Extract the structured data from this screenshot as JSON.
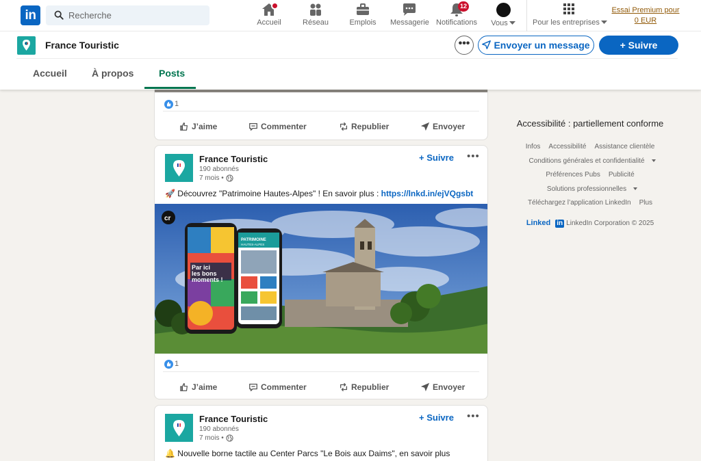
{
  "nav": {
    "logo": "in",
    "search_placeholder": "Recherche",
    "items": [
      {
        "label": "Accueil",
        "icon": "home-icon"
      },
      {
        "label": "Réseau",
        "icon": "network-icon"
      },
      {
        "label": "Emplois",
        "icon": "briefcase-icon"
      },
      {
        "label": "Messagerie",
        "icon": "messaging-icon"
      },
      {
        "label": "Notifications",
        "icon": "bell-icon",
        "badge": "12"
      },
      {
        "label": "Vous",
        "icon": "avatar"
      },
      {
        "label": "Pour les entreprises",
        "icon": "grid-icon"
      }
    ],
    "premium": "Essai Premium pour 0 EUR"
  },
  "page": {
    "name": "France Touristic",
    "more": "•••",
    "message_button": "Envoyer un message",
    "follow_button": "+ Suivre",
    "tabs": [
      "Accueil",
      "À propos",
      "Posts"
    ],
    "active_tab": "Posts"
  },
  "posts": [
    {
      "reaction_count": "1",
      "actions": [
        "J’aime",
        "Commenter",
        "Republier",
        "Envoyer"
      ]
    },
    {
      "author": "France Touristic",
      "followers": "190 abonnés",
      "time": "7 mois •",
      "follow": "+ Suivre",
      "more": "•••",
      "text_emoji": "🚀",
      "text": "Découvrez \"Patrimoine Hautes-Alpes\" ! En savoir plus : ",
      "link": "https://lnkd.in/ejVQgsbt",
      "image": {
        "badge": "cr",
        "phone_brand": "PATRIMOINE",
        "phone_brand_sub": "HAUTES-ALPES",
        "phone_slogan": "Par ici les bons moments !"
      },
      "reaction_count": "1",
      "actions": [
        "J’aime",
        "Commenter",
        "Republier",
        "Envoyer"
      ]
    },
    {
      "author": "France Touristic",
      "followers": "190 abonnés",
      "time": "7 mois •",
      "follow": "+ Suivre",
      "more": "•••",
      "text_emoji": "🔔",
      "text": "Nouvelle borne tactile au Center Parcs \"Le Bois aux Daims\", en savoir plus"
    }
  ],
  "rail": {
    "title": "Accessibilité : partiellement conforme",
    "links_row1": [
      "Infos",
      "Accessibilité",
      "Assistance clientèle"
    ],
    "links_row2": "Conditions générales et confidentialité",
    "links_row3": [
      "Préférences Pubs",
      "Publicité"
    ],
    "links_row4": "Solutions professionnelles",
    "links_row5": [
      "Téléchargez l’application LinkedIn",
      "Plus"
    ],
    "brand_text": "Linked",
    "brand_box": "in",
    "copyright": "LinkedIn Corporation © 2025"
  },
  "colors": {
    "brand": "#0a66c2",
    "active_tab": "#01754f",
    "page_logo": "#1ba7a1",
    "notification_badge": "#cb112d",
    "premium_text": "#915907"
  }
}
